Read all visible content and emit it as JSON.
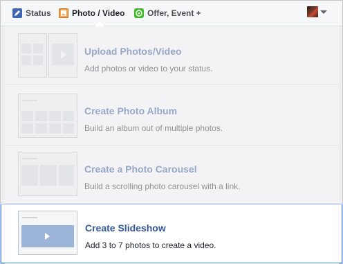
{
  "tabs": [
    {
      "label": "Status",
      "icon": "pencil-icon"
    },
    {
      "label": "Photo / Video",
      "icon": "photo-icon"
    },
    {
      "label": "Offer, Event +",
      "icon": "offer-icon"
    }
  ],
  "menu": [
    {
      "title": "Upload Photos/Video",
      "description": "Add photos or video to your status."
    },
    {
      "title": "Create Photo Album",
      "description": "Build an album out of multiple photos."
    },
    {
      "title": "Create a Photo Carousel",
      "description": "Build a scrolling photo carousel with a link."
    },
    {
      "title": "Create Slideshow",
      "description": "Add 3 to 7 photos to create a video."
    }
  ],
  "colors": {
    "link": "#365899",
    "focus_border": "#4080ff",
    "status_icon": "#4267b2",
    "photo_icon": "#f7a350",
    "offer_icon": "#42b72a"
  }
}
